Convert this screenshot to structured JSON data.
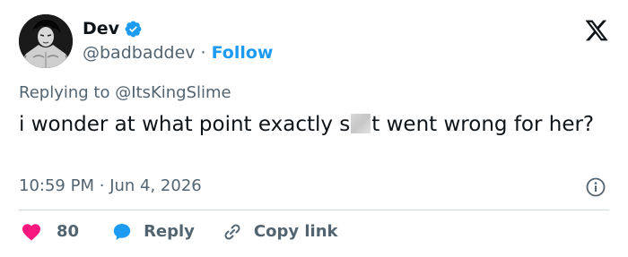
{
  "author": {
    "display_name": "Dev",
    "handle": "@badbaddev",
    "separator": "·",
    "follow_label": "Follow"
  },
  "reply_context": {
    "prefix": "Replying to ",
    "mention": "@ItsKingSlime"
  },
  "tweet": {
    "text_before": "i wonder at what point exactly s",
    "text_after": "t went wrong for her?"
  },
  "meta": {
    "time": "10:59 PM",
    "separator": "·",
    "date": "Jun 4, 2026"
  },
  "actions": {
    "like_count": "80",
    "reply_label": "Reply",
    "copy_label": "Copy link"
  },
  "colors": {
    "accent": "#1d9bf0",
    "like": "#f91880",
    "text": "#0f1419",
    "secondary": "#536471"
  },
  "icons": [
    "avatar",
    "verified-badge-icon",
    "x-logo-icon",
    "info-icon",
    "heart-icon",
    "reply-bubble-icon",
    "link-icon"
  ]
}
